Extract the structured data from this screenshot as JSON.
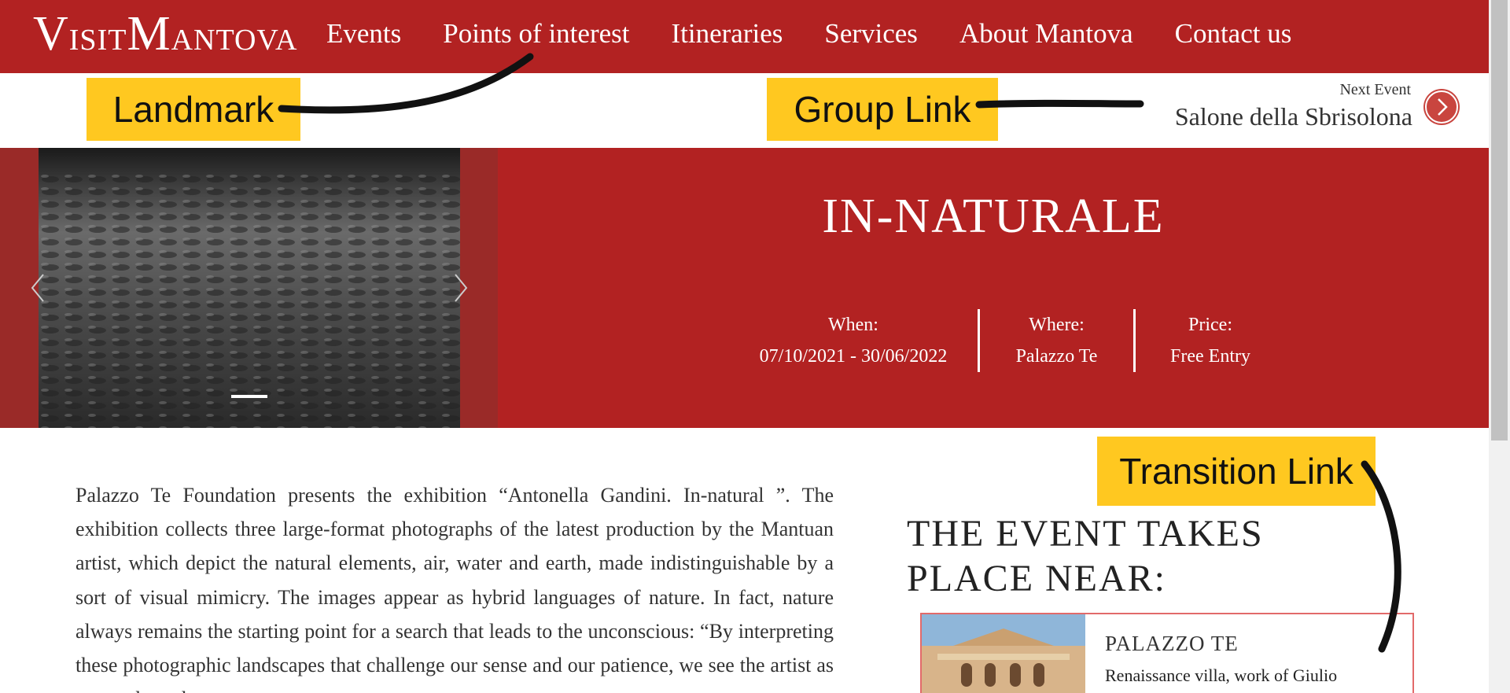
{
  "header": {
    "logo_text": "VisitMantova",
    "nav_items": [
      "Events",
      "Points of interest",
      "Itineraries",
      "Services",
      "About Mantova",
      "Contact us"
    ]
  },
  "next_event": {
    "label": "Next Event",
    "title": "Salone della Sbrisolona"
  },
  "event": {
    "title": "IN-NATURALE",
    "when_label": "When:",
    "when_value": "07/10/2021 - 30/06/2022",
    "where_label": "Where:",
    "where_value": "Palazzo Te",
    "price_label": "Price:",
    "price_value": "Free Entry"
  },
  "article": {
    "text": "Palazzo Te Foundation presents the exhibition “Antonella Gandini. In-natural ”. The exhibition collects three large-format photographs of the latest production by the Mantuan artist, which depict the natural elements, air, water and earth, made indistinguishable by a sort of visual mimicry. The images appear as hybrid languages of nature. In fact, nature always remains the starting point for a search that leads to the unconscious: “By interpreting these photographic landscapes that challenge our sense and our patience, we see the artist as we see how the"
  },
  "near": {
    "heading": "THE EVENT TAKES PLACE NEAR:",
    "card_title": "PALAZZO TE",
    "card_desc": "Renaissance villa, work of Giulio"
  },
  "annotations": {
    "landmark": "Landmark",
    "group_link": "Group Link",
    "transition_link": "Transition Link"
  },
  "colors": {
    "brand_red": "#b22222",
    "annotation_yellow": "#ffc820",
    "card_border": "#e26a6a"
  }
}
